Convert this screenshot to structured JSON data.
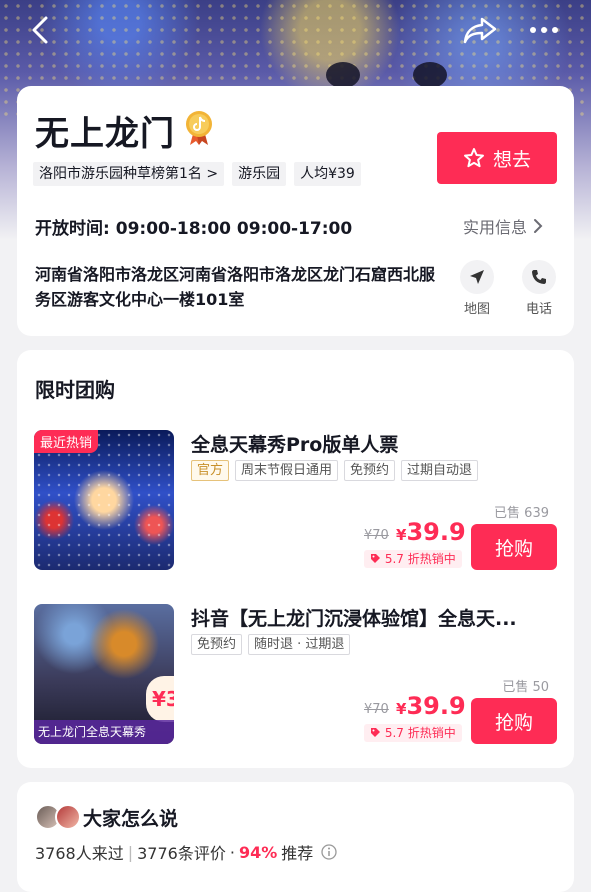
{
  "topbar": {
    "back_icon": "chevron-left-icon",
    "share_icon": "share-icon",
    "more_icon": "more-icon"
  },
  "place": {
    "title": "无上龙门",
    "badge_icon": "douyin-medal-icon",
    "want_label": "想去",
    "tags": [
      "洛阳市游乐园种草榜第1名 >",
      "游乐园",
      "人均¥39"
    ],
    "hours_label": "开放时间:",
    "hours_value": "09:00-18:00 09:00-17:00",
    "practical_label": "实用信息",
    "address": "河南省洛阳市洛龙区河南省洛阳市洛龙区龙门石窟西北服务区游客文化中心一楼101室",
    "map_label": "地图",
    "phone_label": "电话"
  },
  "deals": {
    "section_title": "限时团购",
    "items": [
      {
        "image_badge": "最近热销",
        "title": "全息天幕秀Pro版单人票",
        "tags": [
          "官方",
          "周末节假日通用",
          "免预约",
          "过期自动退"
        ],
        "sold": "已售 639",
        "original_price": "¥70",
        "price_symbol": "¥",
        "price": "39.9",
        "discount": "5.7 折热销中",
        "buy_label": "抢购"
      },
      {
        "image_caption": "无上龙门全息天幕秀",
        "image_corner": "¥3",
        "title": "抖音【无上龙门沉浸体验馆】全息天...",
        "tags": [
          "免预约",
          "随时退 · 过期退"
        ],
        "sold": "已售 50",
        "original_price": "¥70",
        "price_symbol": "¥",
        "price": "39.9",
        "discount": "5.7 折热销中",
        "buy_label": "抢购"
      }
    ]
  },
  "reviews": {
    "title": "大家怎么说",
    "visited": "3768人来过",
    "count": "3776条评价",
    "dot": "·",
    "recommend_pct": "94%",
    "recommend_label": "推荐"
  },
  "colors": {
    "accent": "#fe2c55",
    "official_tag": "#c8902a"
  }
}
